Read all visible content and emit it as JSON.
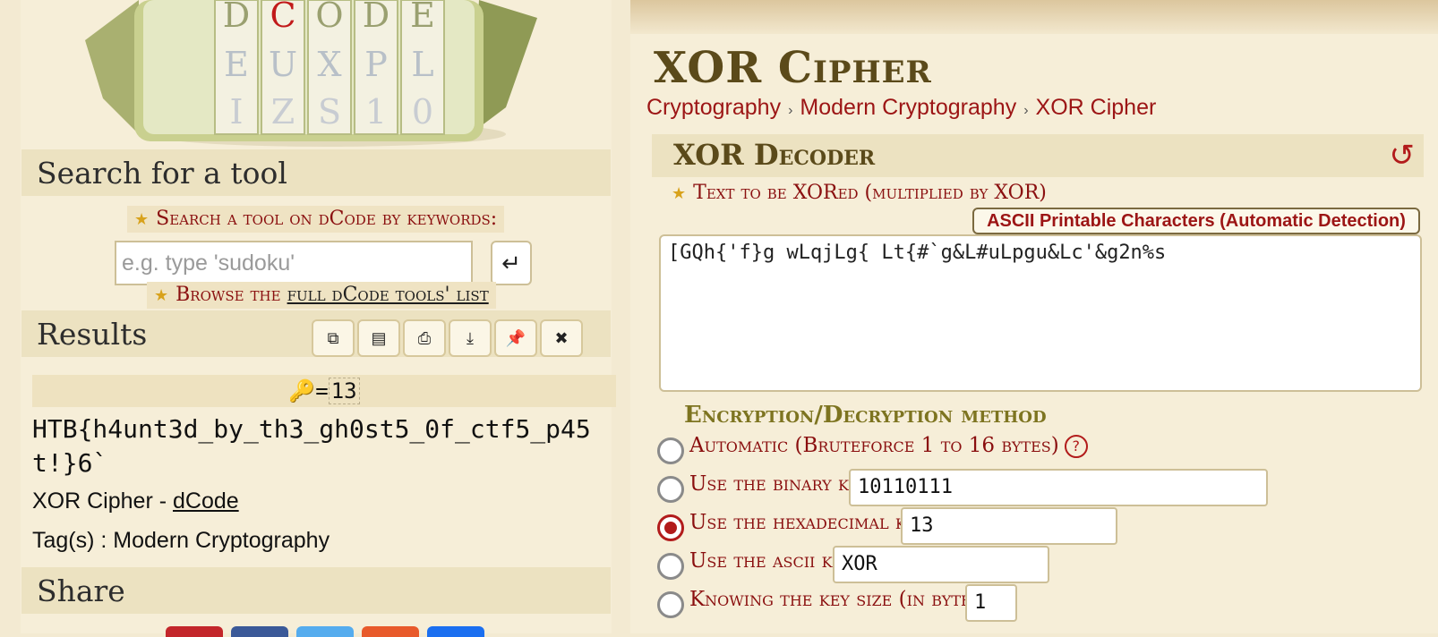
{
  "left": {
    "search_section_title": "Search for a tool",
    "search_keywords_label": "Search a tool on dCode by keywords:",
    "search_placeholder": "e.g. type 'sudoku'",
    "browse_prefix": "Browse the",
    "browse_link": "full dCode tools' list",
    "results_title": "Results",
    "result_key_value": "13",
    "result_text": "HTB{h4unt3d_by_th3_gh0st5_0f_ctf5_p45t!}6`",
    "result_source_prefix": "XOR Cipher - ",
    "result_source_link": "dCode",
    "result_tags": "Tag(s) : Modern Cryptography",
    "share_title": "Share"
  },
  "main": {
    "page_title": "XOR Cipher",
    "breadcrumb": [
      "Cryptography",
      "Modern Cryptography",
      "XOR Cipher"
    ],
    "decoder_title": "XOR Decoder",
    "text_label": "Text to be XORed (multiplied by XOR)",
    "ascii_detect_label": "ASCII Printable Characters (Automatic Detection)",
    "cipher_text": "[GQh{'f}g wLqjLg{ Lt{#`g&L#uLpgu&Lc'&g2n%s",
    "method_title": "Encryption/Decryption method",
    "options": {
      "automatic": "Automatic (Bruteforce 1 to 16 bytes)",
      "binary_label": "Use the binary key",
      "binary_value": "10110111",
      "hex_label": "Use the hexadecimal key",
      "hex_value": "13",
      "ascii_label": "Use the ascii key",
      "ascii_value": "XOR",
      "keysize_label": "Knowing the key size (in bytes)",
      "keysize_value": "1"
    },
    "selected_option": "hexadecimal"
  },
  "colors": {
    "accent_red": "#8a0f0f",
    "title_brown": "#5b4a1a",
    "method_olive": "#7d7420",
    "header_bg": "#ece2c1"
  }
}
